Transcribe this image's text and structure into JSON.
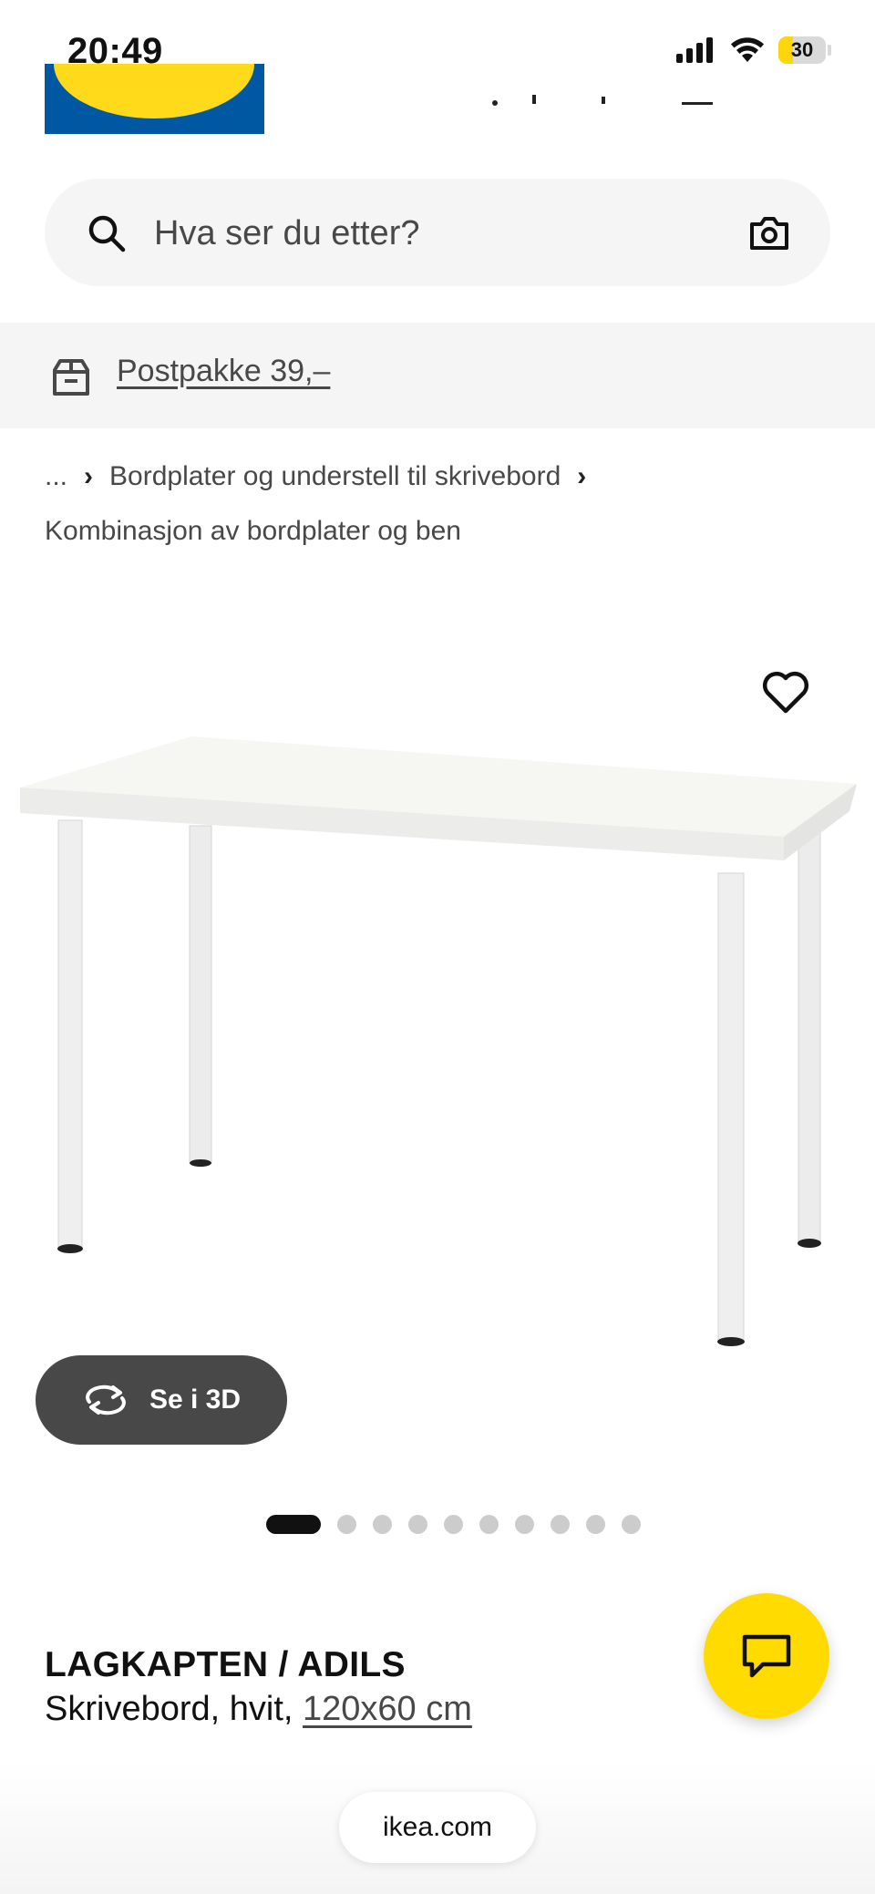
{
  "status_bar": {
    "time": "20:49",
    "battery": "30",
    "icons": [
      "cellular-signal-icon",
      "wifi-icon",
      "battery-icon"
    ]
  },
  "header": {
    "logo": "ikea-logo"
  },
  "search": {
    "placeholder": "Hva ser du etter?",
    "icons": [
      "search-icon",
      "camera-icon"
    ]
  },
  "banner": {
    "icon": "parcel-box-icon",
    "link": "Postpakke 39,–"
  },
  "breadcrumb": {
    "ellipsis": "...",
    "items": [
      "Bordplater og understell til skrivebord",
      "Kombinasjon av bordplater og ben"
    ]
  },
  "product": {
    "image_alt_icon": "white-desk-image",
    "favorite_icon": "heart-icon",
    "view_3d_label": "Se i 3D",
    "carousel_total": 10,
    "carousel_active_index": 0,
    "name": "LAGKAPTEN / ADILS",
    "description": "Skrivebord, hvit,",
    "dimensions": "120x60 cm"
  },
  "chat": {
    "icon": "chat-bubble-icon"
  },
  "browser": {
    "url": "ikea.com"
  },
  "colors": {
    "ikea_blue": "#0058a3",
    "ikea_yellow": "#ffda1a",
    "chat_yellow": "#ffdb00",
    "banner_bg": "#f5f5f5",
    "button_dark": "#484848"
  }
}
